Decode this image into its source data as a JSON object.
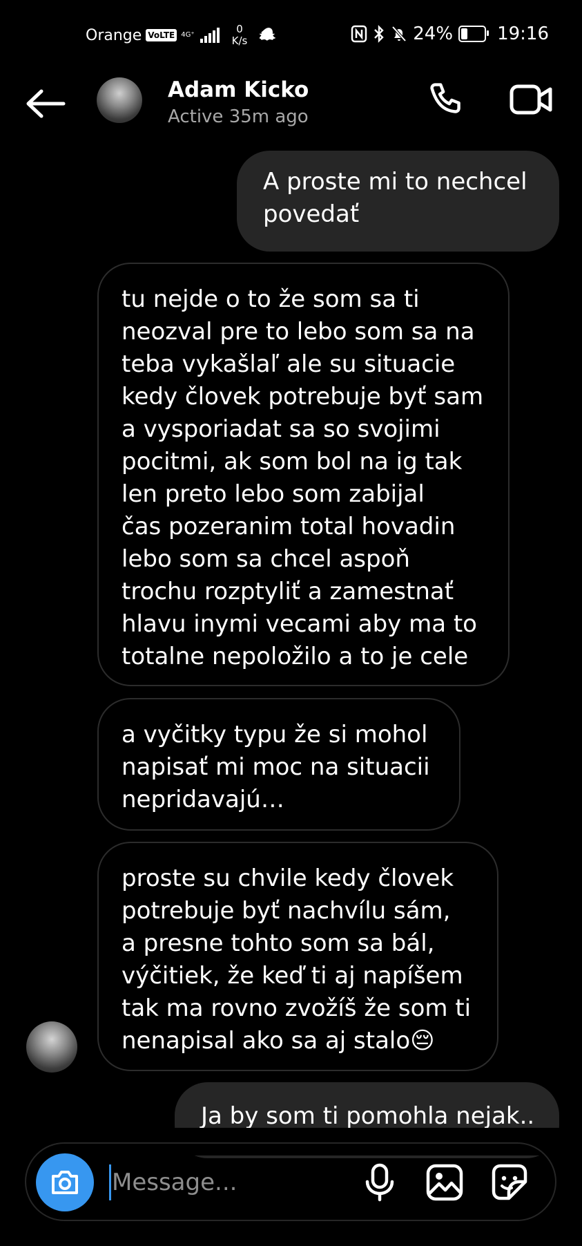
{
  "status_bar": {
    "carrier": "Orange",
    "volte": "VoLTE",
    "network": "4G⁺",
    "speed_value": "0",
    "speed_unit": "K/s",
    "battery": "24%",
    "battery_level": 0.24,
    "time": "19:16"
  },
  "header": {
    "name": "Adam Kicko",
    "status": "Active 35m ago"
  },
  "messages": [
    {
      "direction": "outgoing",
      "text": "A proste mi to nechcel\npovedať"
    },
    {
      "direction": "incoming",
      "text": "tu nejde o to že som sa ti\nneozval pre to lebo som sa na\nteba vykašlaľ ale su situacie\nkedy človek potrebuje byť sam\na vysporiadat sa so svojimi\npocitmi, ak som bol na ig tak\nlen preto lebo som zabijal\nčas pozeranim total hovadin\nlebo som sa chcel aspoň\ntrochu rozptyliť a zamestnať\nhlavu inymi vecami aby ma to\ntotalne nepoložilo a to je cele"
    },
    {
      "direction": "incoming",
      "text": "a vyčitky typu že si mohol\nnapisať mi moc na situacii\nnepridavajú…"
    },
    {
      "direction": "incoming",
      "text": "proste su chvile kedy človek\npotrebuje byť nachvílu sám,\na presne tohto som sa bál,\nvýčitiek, že keď ti aj napíšem\ntak ma rovno zvožíš že som ti\nnenapisal ako sa aj stalo😔"
    },
    {
      "direction": "outgoing",
      "text": "Ja by som ti pomohla nejak.."
    }
  ],
  "composer": {
    "placeholder": "Message..."
  },
  "icons": {
    "back": "arrow-left",
    "call": "phone",
    "video": "video-camera",
    "camera": "camera",
    "mic": "microphone",
    "gallery": "image",
    "sticker": "sticker"
  },
  "colors": {
    "accent": "#3797f0",
    "outgoing_bubble": "#262626",
    "incoming_border": "#2c2c2c",
    "secondary_text": "#a8a8a8"
  }
}
